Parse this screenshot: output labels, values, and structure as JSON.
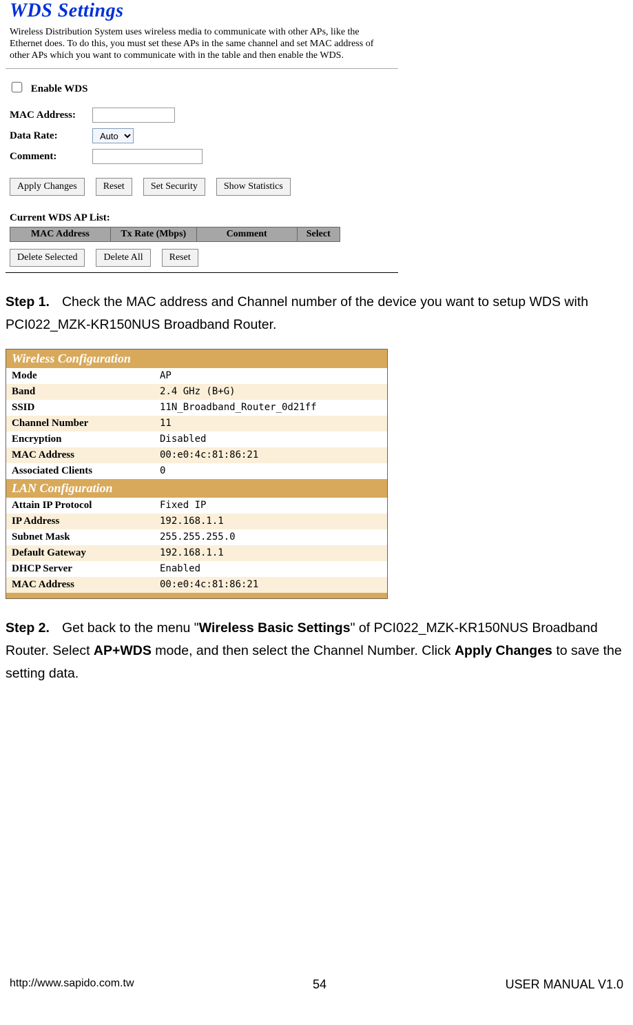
{
  "wds": {
    "title": "WDS Settings",
    "description": "Wireless Distribution System uses wireless media to communicate with other APs, like the Ethernet does. To do this, you must set these APs in the same channel and set MAC address of other APs which you want to communicate with in the table and then enable the WDS.",
    "enable_label": "Enable WDS",
    "mac_label": "MAC Address:",
    "mac_value": "",
    "rate_label": "Data Rate:",
    "rate_value": "Auto",
    "comment_label": "Comment:",
    "comment_value": "",
    "btn_apply": "Apply Changes",
    "btn_reset": "Reset",
    "btn_security": "Set Security",
    "btn_stats": "Show Statistics",
    "subhead": "Current WDS AP List:",
    "th_mac": "MAC Address",
    "th_rate": "Tx Rate (Mbps)",
    "th_comment": "Comment",
    "th_select": "Select",
    "btn_del_sel": "Delete Selected",
    "btn_del_all": "Delete All",
    "btn_reset2": "Reset"
  },
  "step1": {
    "lead": "Step 1.",
    "text_a": "Check the MAC address and Channel number of the device you want to setup WDS with PCI022_MZK-KR150NUS Broadband Router."
  },
  "cfg": {
    "head1": "Wireless Configuration",
    "rows1": [
      {
        "k": "Mode",
        "v": "AP"
      },
      {
        "k": "Band",
        "v": "2.4 GHz (B+G)"
      },
      {
        "k": "SSID",
        "v": "11N_Broadband_Router_0d21ff"
      },
      {
        "k": "Channel Number",
        "v": "11"
      },
      {
        "k": "Encryption",
        "v": "Disabled"
      },
      {
        "k": "MAC Address",
        "v": "00:e0:4c:81:86:21"
      },
      {
        "k": "Associated Clients",
        "v": "0"
      }
    ],
    "head2": "LAN Configuration",
    "rows2": [
      {
        "k": "Attain IP Protocol",
        "v": "Fixed IP"
      },
      {
        "k": "IP Address",
        "v": "192.168.1.1"
      },
      {
        "k": "Subnet Mask",
        "v": "255.255.255.0"
      },
      {
        "k": "Default Gateway",
        "v": "192.168.1.1"
      },
      {
        "k": "DHCP Server",
        "v": "Enabled"
      },
      {
        "k": "MAC Address",
        "v": "00:e0:4c:81:86:21"
      }
    ]
  },
  "step2": {
    "lead": "Step 2.",
    "t1": "Get back to the menu \"",
    "b1": "Wireless Basic Settings",
    "t2": "\" of PCI022_MZK-KR150NUS Broadband Router.    Select ",
    "b2": "AP+WDS",
    "t3": " mode, and then select the Channel Number. Click ",
    "b3": "Apply Changes",
    "t4": " to save the setting data."
  },
  "footer": {
    "url": "http://www.sapido.com.tw",
    "page": "54",
    "ver": "USER MANUAL V1.0"
  }
}
